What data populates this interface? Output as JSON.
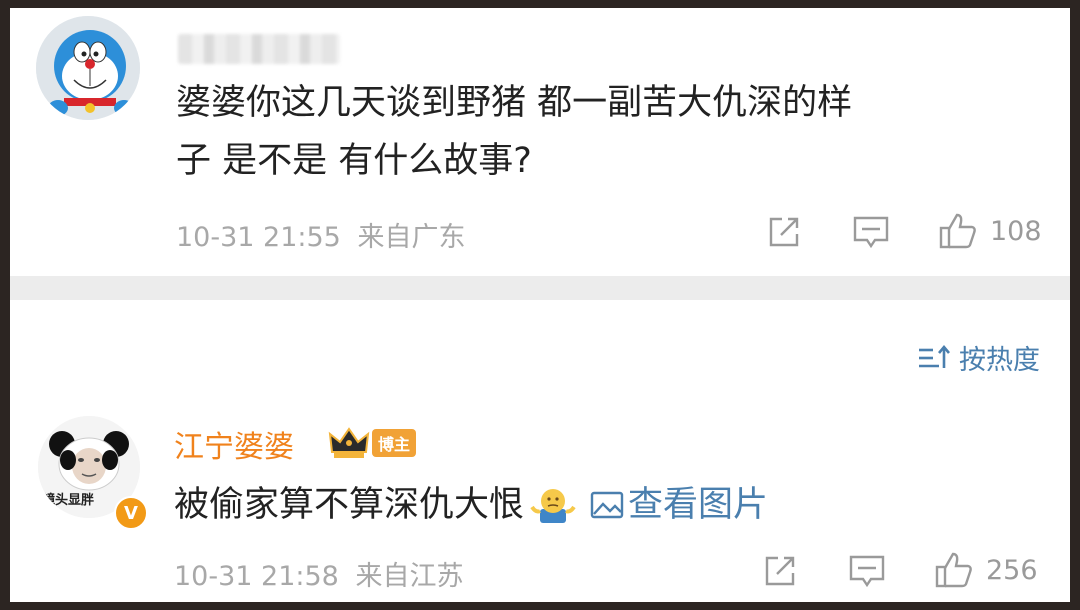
{
  "comment1": {
    "text_line1": "婆婆你这几天谈到野猪 都一副苦大仇深的样",
    "text_line2": "子 是不是 有什么故事?",
    "time": "10-31 21:55",
    "location": "来自广东",
    "likes": "108"
  },
  "sort": {
    "label": "按热度"
  },
  "comment2": {
    "username": "江宁婆婆",
    "badge_label": "博主",
    "avatar_caption": "镜头显胖",
    "avatar_badge": "V",
    "text": "被偷家算不算深仇大恨",
    "view_image_label": "查看图片",
    "time": "10-31 21:58",
    "location": "来自江苏",
    "likes": "256"
  },
  "colors": {
    "username": "#f0821c",
    "link": "#4a7fae",
    "meta": "#a8a8a8",
    "verified": "#f29a16"
  },
  "icons": {
    "avatar1": "doraemon-avatar",
    "avatar2": "panda-meme-avatar",
    "repost": "repost-icon",
    "comment": "comment-icon",
    "like": "thumbs-up-icon",
    "sort": "sort-icon",
    "crown": "crown-badge-icon",
    "emoji": "shrug-emoji-icon",
    "image": "image-icon"
  }
}
